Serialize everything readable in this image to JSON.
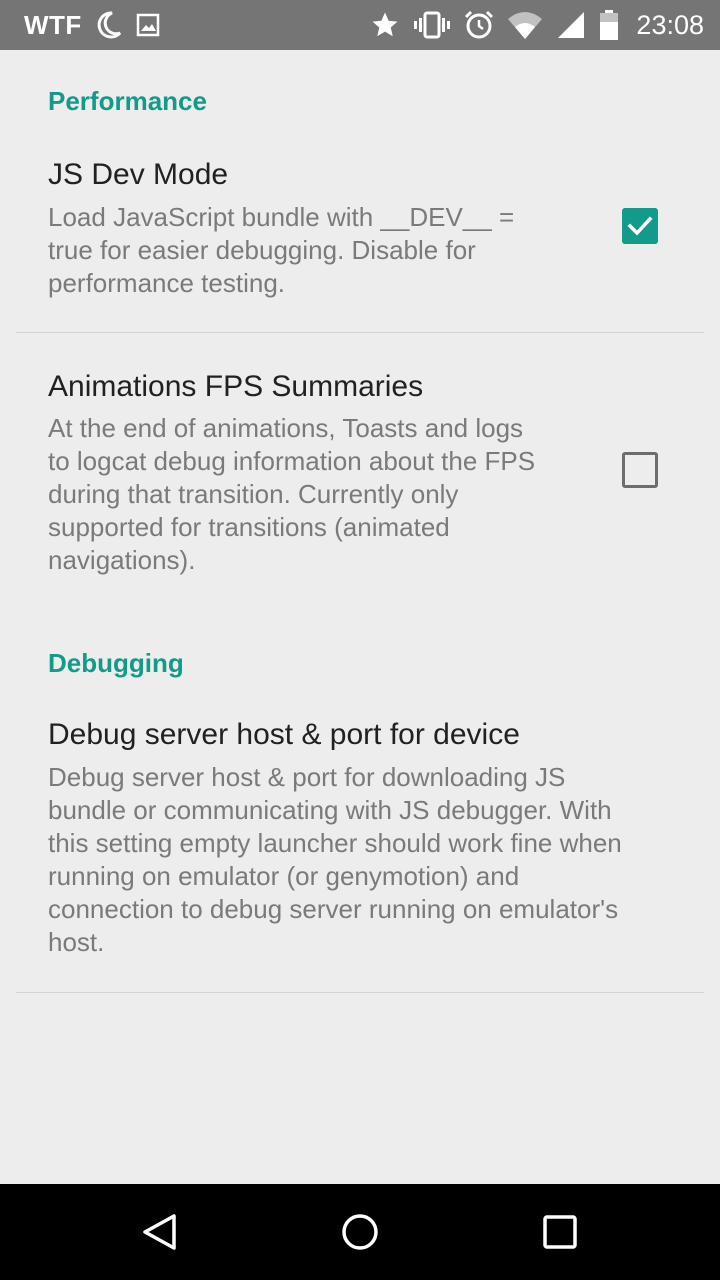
{
  "status_bar": {
    "carrier": "WTF",
    "time": "23:08",
    "icons": [
      "moon-icon",
      "image-icon",
      "star-icon",
      "vibrate-icon",
      "alarm-icon",
      "wifi-icon",
      "signal-icon",
      "battery-icon"
    ]
  },
  "categories": {
    "performance": "Performance",
    "debugging": "Debugging"
  },
  "preferences": {
    "js_dev_mode": {
      "title": "JS Dev Mode",
      "summary_lines": [
        "Load JavaScript bundle with __DEV__ =",
        "true for easier debugging.  Disable for",
        "performance testing."
      ],
      "checked": true
    },
    "animations_fps": {
      "title": "Animations FPS Summaries",
      "summary_lines": [
        "At the end of animations, Toasts and logs",
        "to logcat debug information about the FPS",
        "during that transition. Currently only",
        "supported for transitions (animated",
        "navigations)."
      ],
      "checked": false
    },
    "debug_server": {
      "title": "Debug server host & port for device",
      "summary_lines": [
        "Debug server host & port for downloading JS",
        "bundle or communicating with JS debugger. With",
        "this setting empty launcher should work fine when",
        "running on emulator (or genymotion) and",
        "connection to debug server running on emulator's",
        "host."
      ]
    }
  },
  "colors": {
    "accent": "#129a8a",
    "status_bar": "#757575",
    "background": "#ededed",
    "nav_bar": "#000000"
  },
  "nav_bar": {
    "icons": [
      "back-icon",
      "home-icon",
      "recents-icon"
    ]
  }
}
